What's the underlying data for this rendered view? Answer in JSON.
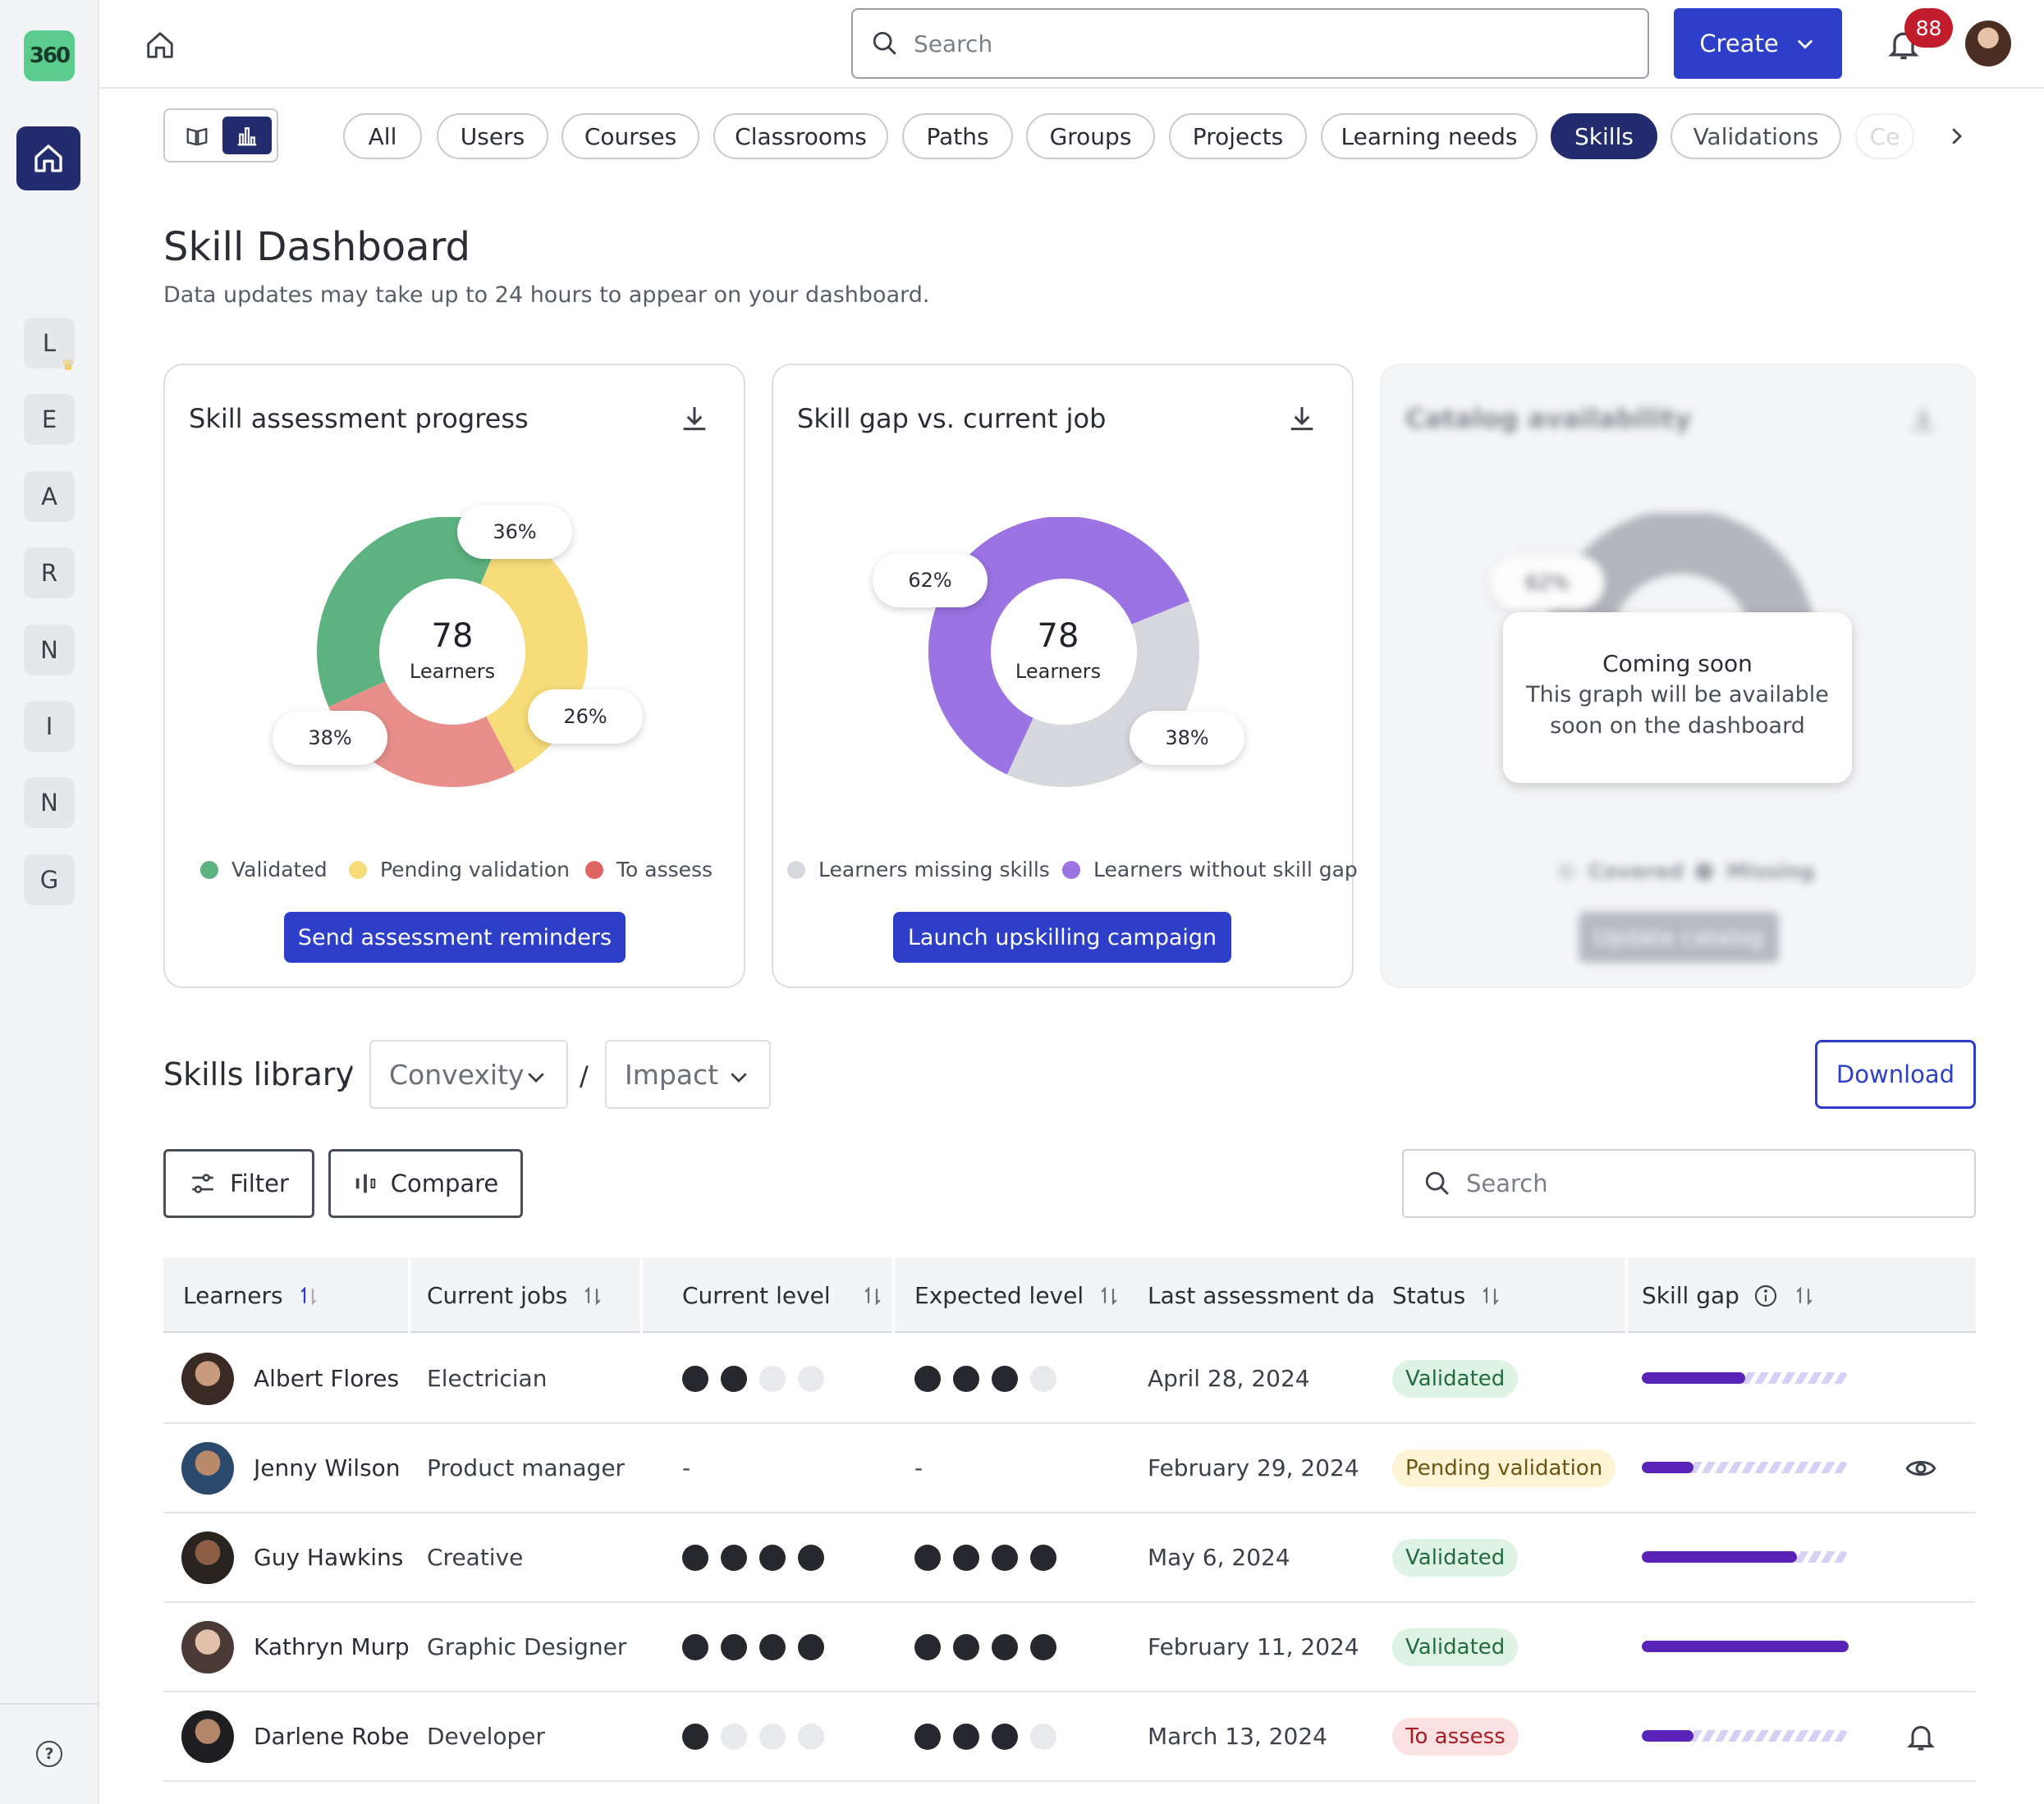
{
  "app": {
    "logo_text": "360"
  },
  "rail": {
    "letters": [
      "L",
      "E",
      "A",
      "R",
      "N",
      "I",
      "N",
      "G"
    ],
    "help_symbol": "?",
    "crown_glyph": "♛"
  },
  "topbar": {
    "search_placeholder": "Search",
    "create_label": "Create",
    "notifications_count": "88"
  },
  "tabs": [
    {
      "label": "All",
      "active": false
    },
    {
      "label": "Users",
      "active": false
    },
    {
      "label": "Courses",
      "active": false
    },
    {
      "label": "Classrooms",
      "active": false
    },
    {
      "label": "Paths",
      "active": false
    },
    {
      "label": "Groups",
      "active": false
    },
    {
      "label": "Projects",
      "active": false
    },
    {
      "label": "Learning needs",
      "active": false
    },
    {
      "label": "Skills",
      "active": true
    },
    {
      "label": "Validations",
      "active": false
    },
    {
      "label": "Ce",
      "active": false
    }
  ],
  "page": {
    "title": "Skill Dashboard",
    "subtitle": "Data updates may take up to 24 hours to appear on your dashboard."
  },
  "cards": {
    "assessment": {
      "title": "Skill assessment progress",
      "center_value": "78",
      "center_label": "Learners",
      "button_label": "Send assessment reminders",
      "chart_data": {
        "type": "pie",
        "title": "Skill assessment progress",
        "categories": [
          "Validated",
          "Pending validation",
          "To assess"
        ],
        "values": [
          38,
          36,
          26
        ],
        "labels": [
          "38%",
          "36%",
          "26%"
        ],
        "colors": [
          "#5cb37f",
          "#f7dc7a",
          "#e88f8b"
        ],
        "legend": "bottom"
      }
    },
    "skill_gap": {
      "title": "Skill gap vs. current job",
      "center_value": "78",
      "center_label": "Learners",
      "button_label": "Launch upskilling campaign",
      "chart_data": {
        "type": "pie",
        "title": "Skill gap vs. current job",
        "categories": [
          "Learners missing skills",
          "Learners without skill gap"
        ],
        "values": [
          38,
          62
        ],
        "labels": [
          "38%",
          "62%"
        ],
        "colors": [
          "#d7d8dd",
          "#9b73e3"
        ],
        "legend": "bottom"
      }
    },
    "catalog": {
      "title": "Catalog availability",
      "pill_label": "62%",
      "legend": [
        "Covered",
        "Missing"
      ],
      "button_label": "Update catalog",
      "coming_title": "Coming soon",
      "coming_line1": "This graph will be available",
      "coming_line2": "soon on the dashboard"
    }
  },
  "library": {
    "title": "Skills library",
    "separator": "/",
    "dropdown1": "Convexity",
    "dropdown2": "Impact",
    "download_label": "Download",
    "filter_label": "Filter",
    "compare_label": "Compare",
    "search_placeholder": "Search"
  },
  "table": {
    "columns": [
      "Learners",
      "Current jobs",
      "Current level",
      "Expected level",
      "Last assessment date",
      "Status",
      "Skill gap"
    ],
    "rows": [
      {
        "name": "Albert Flores",
        "job": "Electrician",
        "current_level": 2,
        "expected_level": 3,
        "current_text": "",
        "expected_text": "",
        "date": "April 28, 2024",
        "status": "Validated",
        "status_kind": "validated",
        "gap_progress": 0.5,
        "action_icon": ""
      },
      {
        "name": "Jenny Wilson",
        "job": "Product manager",
        "current_level": null,
        "expected_level": null,
        "current_text": "-",
        "expected_text": "-",
        "date": "February 29, 2024",
        "status": "Pending validation",
        "status_kind": "pending",
        "gap_progress": 0.25,
        "action_icon": "eye-icon"
      },
      {
        "name": "Guy Hawkins",
        "job": "Creative",
        "current_level": 4,
        "expected_level": 4,
        "current_text": "",
        "expected_text": "",
        "date": "May 6, 2024",
        "status": "Validated",
        "status_kind": "validated",
        "gap_progress": 0.75,
        "action_icon": ""
      },
      {
        "name": "Kathryn Murphy",
        "job": "Graphic Designer",
        "current_level": 4,
        "expected_level": 4,
        "current_text": "",
        "expected_text": "",
        "date": "February 11, 2024",
        "status": "Validated",
        "status_kind": "validated",
        "gap_progress": 1.0,
        "action_icon": ""
      },
      {
        "name": "Darlene Robertson",
        "job": "Developer",
        "current_level": 1,
        "expected_level": 3,
        "current_text": "",
        "expected_text": "",
        "date": "March 13, 2024",
        "status": "To assess",
        "status_kind": "assess",
        "gap_progress": 0.25,
        "action_icon": "bell-icon"
      }
    ]
  }
}
